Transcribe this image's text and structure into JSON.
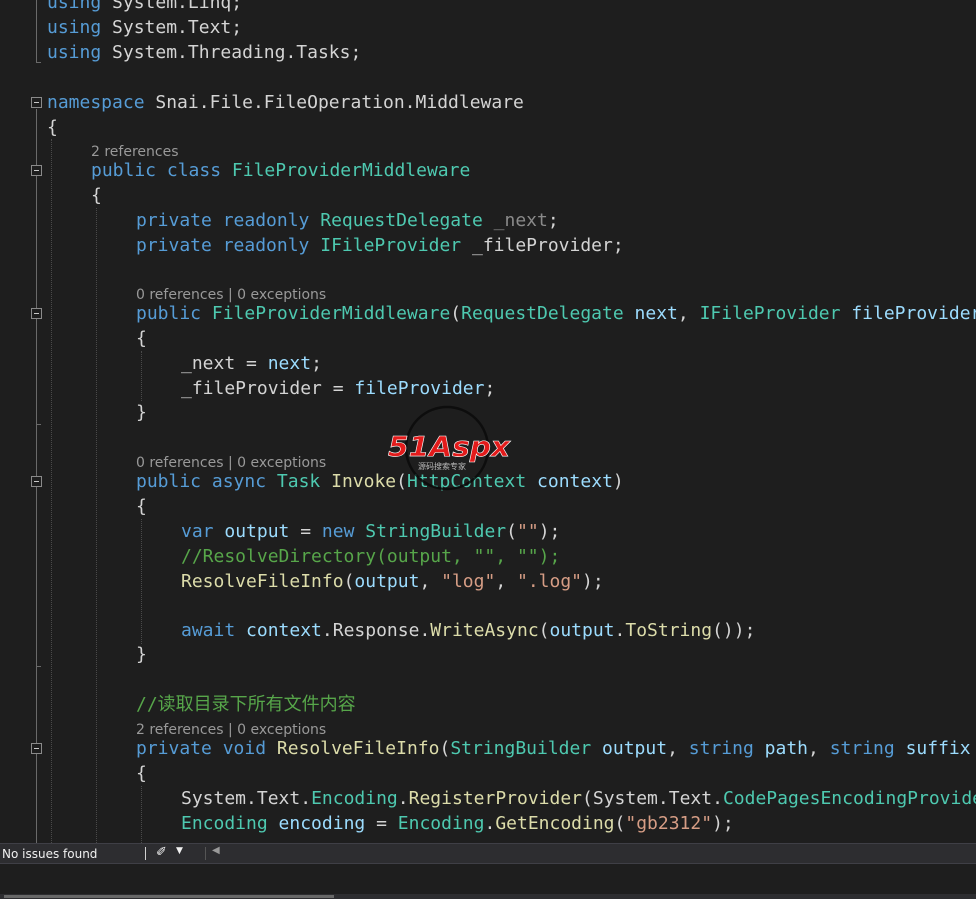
{
  "editor": {
    "lines": {
      "l1": {
        "t1": "using",
        "t2": " System",
        "t3": ".",
        "t4": "Linq",
        "t5": ";"
      },
      "l2": {
        "t1": "using",
        "t2": " System",
        "t3": ".",
        "t4": "Text",
        "t5": ";"
      },
      "l3": {
        "t1": "using",
        "t2": " System",
        "t3": ".",
        "t4": "Threading",
        "t5": ".",
        "t6": "Tasks",
        "t7": ";"
      },
      "l4": {
        "t1": "namespace",
        "t2": " Snai",
        "t3": ".",
        "t4": "File",
        "t5": ".",
        "t6": "FileOperation",
        "t7": ".",
        "t8": "Middleware"
      },
      "l5": {
        "t1": "{"
      },
      "l6": {
        "t1": "public",
        "t2": " ",
        "t3": "class",
        "t4": " ",
        "t5": "FileProviderMiddleware"
      },
      "l7": {
        "t1": "{"
      },
      "l8": {
        "t1": "private",
        "t2": " ",
        "t3": "readonly",
        "t4": " ",
        "t5": "RequestDelegate",
        "t6": " ",
        "t7": "_next",
        "t8": ";"
      },
      "l9": {
        "t1": "private",
        "t2": " ",
        "t3": "readonly",
        "t4": " ",
        "t5": "IFileProvider",
        "t6": " _fileProvider;"
      },
      "l10": {
        "t1": "public",
        "t2": " ",
        "t3": "FileProviderMiddleware",
        "t4": "(",
        "t5": "RequestDelegate",
        "t6": " ",
        "t7": "next",
        "t8": ", ",
        "t9": "IFileProvider",
        "t10": " ",
        "t11": "fileProvider"
      },
      "l11": {
        "t1": "{"
      },
      "l12": {
        "t1": "_next",
        "t2": " = ",
        "t3": "next",
        "t4": ";"
      },
      "l13": {
        "t1": "_fileProvider",
        "t2": " = ",
        "t3": "fileProvider",
        "t4": ";"
      },
      "l14": {
        "t1": "}"
      },
      "l15": {
        "t1": "public",
        "t2": " ",
        "t3": "async",
        "t4": " ",
        "t5": "Task",
        "t6": " ",
        "t7": "Invoke",
        "t8": "(",
        "t9": "HttpContext",
        "t10": " ",
        "t11": "context",
        "t12": ")"
      },
      "l16": {
        "t1": "{"
      },
      "l17": {
        "t1": "var",
        "t2": " ",
        "t3": "output",
        "t4": " = ",
        "t5": "new",
        "t6": " ",
        "t7": "StringBuilder",
        "t8": "(",
        "t9": "\"\"",
        "t10": ");"
      },
      "l18": {
        "t1": "//ResolveDirectory(output, \"\", \"\");"
      },
      "l19": {
        "t1": "ResolveFileInfo",
        "t2": "(",
        "t3": "output",
        "t4": ", ",
        "t5": "\"log\"",
        "t6": ", ",
        "t7": "\".log\"",
        "t8": ");"
      },
      "l20": {
        "t1": "await",
        "t2": " ",
        "t3": "context",
        "t4": ".",
        "t5": "Response",
        "t6": ".",
        "t7": "WriteAsync",
        "t8": "(",
        "t9": "output",
        "t10": ".",
        "t11": "ToString",
        "t12": "());"
      },
      "l21": {
        "t1": "}"
      },
      "l22": {
        "t1": "//读取目录下所有文件内容"
      },
      "l23": {
        "t1": "private",
        "t2": " ",
        "t3": "void",
        "t4": " ",
        "t5": "ResolveFileInfo",
        "t6": "(",
        "t7": "StringBuilder",
        "t8": " ",
        "t9": "output",
        "t10": ", ",
        "t11": "string",
        "t12": " ",
        "t13": "path",
        "t14": ", ",
        "t15": "string",
        "t16": " ",
        "t17": "suffix"
      },
      "l24": {
        "t1": "{"
      },
      "l25": {
        "t1": "System",
        "t2": ".",
        "t3": "Text",
        "t4": ".",
        "t5": "Encoding",
        "t6": ".",
        "t7": "RegisterProvider",
        "t8": "(",
        "t9": "System",
        "t10": ".",
        "t11": "Text",
        "t12": ".",
        "t13": "CodePagesEncodingProvider"
      },
      "l26": {
        "t1": "Encoding",
        "t2": " ",
        "t3": "encoding",
        "t4": " = ",
        "t5": "Encoding",
        "t6": ".",
        "t7": "GetEncoding",
        "t8": "(",
        "t9": "\"gb2312\"",
        "t10": ");"
      }
    },
    "codelens": {
      "class_refs": "2 references",
      "ctor": "0 references | 0 exceptions",
      "invoke": "0 references | 0 exceptions",
      "resolve": "2 references | 0 exceptions"
    }
  },
  "watermark": {
    "brand": "51Aspx",
    "sub": "源码搜索专家"
  },
  "statusbar": {
    "issues": "No issues found"
  },
  "colors": {
    "keyword": "#569cd6",
    "type": "#4ec9b0",
    "method": "#dcdcaa",
    "variable": "#9cdcfe",
    "string": "#d69d85",
    "comment": "#57a64a",
    "background": "#1e1e1e"
  }
}
